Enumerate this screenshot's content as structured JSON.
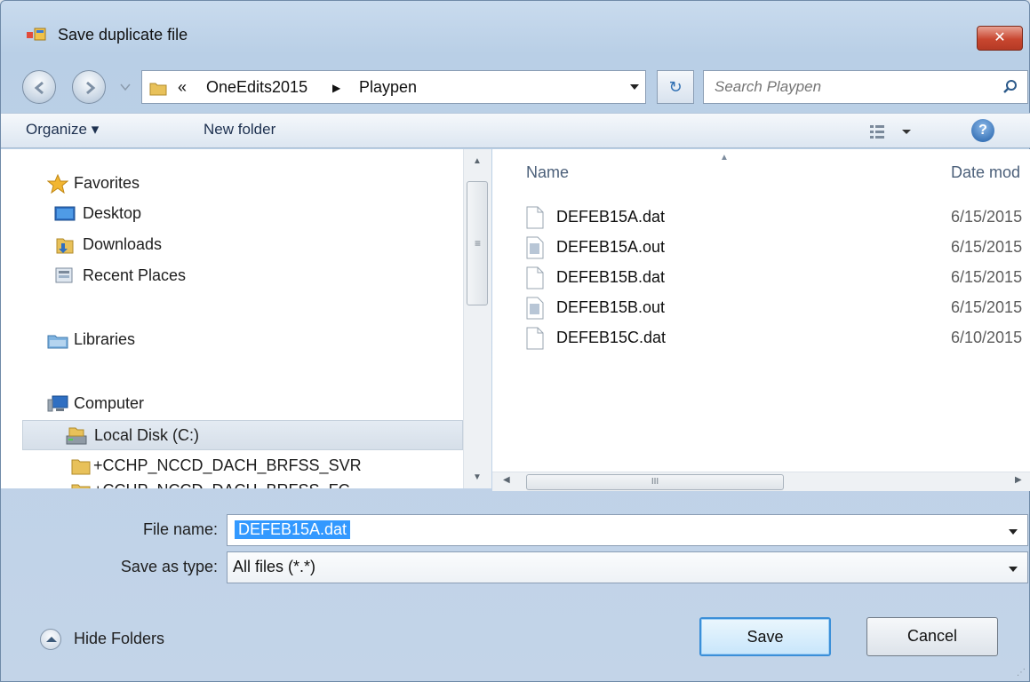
{
  "window": {
    "title": "Save duplicate file",
    "close_label": "✕"
  },
  "address": {
    "overflow_glyph": "«",
    "crumbs": [
      "OneEdits2015",
      "Playpen"
    ],
    "separator": "▶"
  },
  "search": {
    "placeholder": "Search Playpen"
  },
  "toolbar": {
    "organize_label": "Organize ▾",
    "new_folder_label": "New folder",
    "help_label": "?"
  },
  "nav": {
    "favorites": "Favorites",
    "desktop": "Desktop",
    "downloads": "Downloads",
    "recent_places": "Recent Places",
    "libraries": "Libraries",
    "computer": "Computer",
    "local_disk": "Local Disk (C:)",
    "folder_1": "+CCHP_NCCD_DACH_BRFSS_SVR",
    "folder_2": "+CCHP_NCCD_DACH_BRFSS_FC"
  },
  "file_list": {
    "col_name": "Name",
    "col_date": "Date mod",
    "files": [
      {
        "name": "DEFEB15A.dat",
        "date": "6/15/2015",
        "type": "dat"
      },
      {
        "name": "DEFEB15A.out",
        "date": "6/15/2015",
        "type": "out"
      },
      {
        "name": "DEFEB15B.dat",
        "date": "6/15/2015",
        "type": "dat"
      },
      {
        "name": "DEFEB15B.out",
        "date": "6/15/2015",
        "type": "out"
      },
      {
        "name": "DEFEB15C.dat",
        "date": "6/10/2015",
        "type": "dat"
      }
    ]
  },
  "form": {
    "file_name_label": "File name:",
    "file_name_value": "DEFEB15A.dat",
    "save_type_label": "Save as type:",
    "save_type_value": "All files (*.*)"
  },
  "footer": {
    "hide_folders_label": "Hide Folders",
    "save_label": "Save",
    "cancel_label": "Cancel"
  },
  "scroll": {
    "h_thumb_grip": "III",
    "v_thumb_grip": "≡"
  },
  "colors": {
    "selection": "#3399ff",
    "close_button": "#c8462f",
    "default_button_border": "#3b8fd8"
  }
}
